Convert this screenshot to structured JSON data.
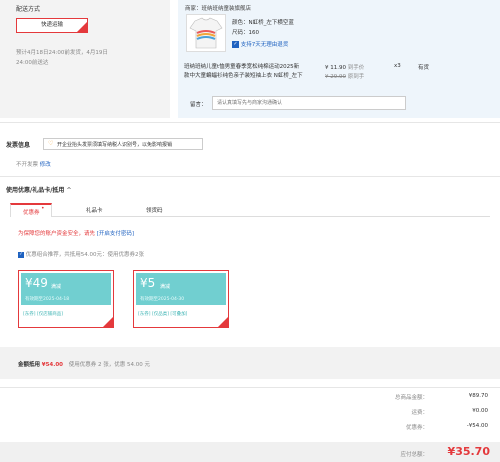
{
  "delivery": {
    "title": "配送方式",
    "method_button": "快递运输",
    "eta_line1": "预计4月18日24:00前发货，4月19日",
    "eta_line2": "24:00前送达"
  },
  "shop": {
    "name": "商家：班纳班纳童装旗舰店",
    "color_label": "颜色：N虹桥_左下横空蓝",
    "size_label": "尺码：160",
    "return_badge": "支持7天无理由退货",
    "product_title_line1": "班纳班纳儿童t恤男童春季宽松纯棉运动2025新",
    "product_title_line2": "款中大童蝙蝠衫纯色亲子装短袖上衣 N虹桥_左下",
    "price_current": "¥ 11.90",
    "price_current_tag": "到手价",
    "price_original": "¥ 29.90",
    "price_original_tag": "原到手",
    "quantity": "x3",
    "stock": "有货",
    "remark_label": "留言：",
    "remark_placeholder": "请认真填写先与商家沟通确认"
  },
  "invoice": {
    "title": "发票信息",
    "notice": "开企业抬头发票须填写纳税人识别号，以免影响报销",
    "status": "不开发票",
    "modify_link": "修改"
  },
  "coupons": {
    "title": "使用优惠/礼品卡/抵用",
    "chevron": "^",
    "tabs": [
      {
        "label": "优惠券",
        "badge": "•"
      },
      {
        "label": "礼品卡"
      },
      {
        "label": "领货码"
      }
    ],
    "security_text": "为保障您的账户资金安全，请先",
    "security_link": "[开启支付密码]",
    "best_combo_text": "优惠组合推荐，共抵用54.00元：使用优惠券2张",
    "cards": [
      {
        "amount": "¥49",
        "type": "满减",
        "expiry": "有效期至2025-04-18",
        "tags": "[东券]  [仅店铺商品]"
      },
      {
        "amount": "¥5",
        "type": "满减",
        "expiry": "有效期至2025-04-30",
        "tags": "[东券]  [仅品类]  [可叠加]"
      }
    ]
  },
  "summary": {
    "label": "金额抵用",
    "amount": "¥54.00",
    "detail": "使用优惠券 2 张，优惠 54.00 元"
  },
  "totals": {
    "goods_label": "总商品金额：",
    "goods_value": "¥89.70",
    "shipping_label": "运费：",
    "shipping_value": "¥0.00",
    "coupon_label": "优惠券：",
    "coupon_value": "-¥54.00",
    "payable_label": "应付总额：",
    "payable_value": "¥35.70"
  },
  "colors": {
    "accent": "#e4393c",
    "coupon": "#71cfd0",
    "link": "#1f62c0"
  }
}
